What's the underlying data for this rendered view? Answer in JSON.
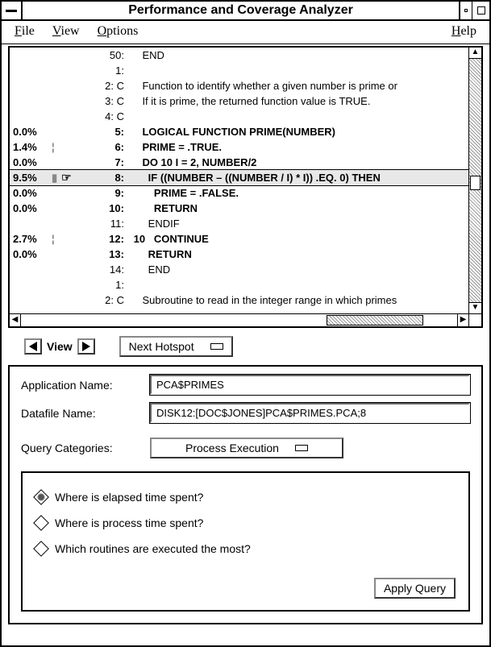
{
  "window": {
    "title": "Performance and Coverage Analyzer"
  },
  "menubar": {
    "file": "File",
    "view": "View",
    "options": "Options",
    "help": "Help"
  },
  "code": {
    "lines": [
      {
        "pct": "",
        "mark": "",
        "ptr": "",
        "lineno": "50:",
        "txt": "    END",
        "bold": false
      },
      {
        "pct": "",
        "mark": "",
        "ptr": "",
        "lineno": "1:",
        "txt": "",
        "bold": false
      },
      {
        "pct": "",
        "mark": "",
        "ptr": "",
        "lineno": "2: C",
        "txt": "    Function to identify whether a given number is prime or",
        "bold": false
      },
      {
        "pct": "",
        "mark": "",
        "ptr": "",
        "lineno": "3: C",
        "txt": "    If it is prime, the returned function value is TRUE.",
        "bold": false
      },
      {
        "pct": "",
        "mark": "",
        "ptr": "",
        "lineno": "4: C",
        "txt": "",
        "bold": false
      },
      {
        "pct": "0.0%",
        "mark": "",
        "ptr": "",
        "lineno": "5:",
        "txt": "    LOGICAL FUNCTION PRIME(NUMBER)",
        "bold": true
      },
      {
        "pct": "1.4%",
        "mark": "¦",
        "ptr": "",
        "lineno": "6:",
        "txt": "    PRIME = .TRUE.",
        "bold": true
      },
      {
        "pct": "0.0%",
        "mark": "",
        "ptr": "",
        "lineno": "7:",
        "txt": "    DO 10 I = 2, NUMBER/2",
        "bold": true
      },
      {
        "pct": "9.5%",
        "mark": "▮",
        "ptr": "☞",
        "lineno": "8:",
        "txt": "      IF ((NUMBER – ((NUMBER / I) * I)) .EQ. 0) THEN",
        "bold": true,
        "sel": true
      },
      {
        "pct": "0.0%",
        "mark": "",
        "ptr": "",
        "lineno": "9:",
        "txt": "        PRIME = .FALSE.",
        "bold": true
      },
      {
        "pct": "0.0%",
        "mark": "",
        "ptr": "",
        "lineno": "10:",
        "txt": "        RETURN",
        "bold": true
      },
      {
        "pct": "",
        "mark": "",
        "ptr": "",
        "lineno": "11:",
        "txt": "      ENDIF",
        "bold": false
      },
      {
        "pct": "2.7%",
        "mark": "¦",
        "ptr": "",
        "lineno": "12:",
        "txt": " 10   CONTINUE",
        "bold": true
      },
      {
        "pct": "0.0%",
        "mark": "",
        "ptr": "",
        "lineno": "13:",
        "txt": "      RETURN",
        "bold": true
      },
      {
        "pct": "",
        "mark": "",
        "ptr": "",
        "lineno": "14:",
        "txt": "      END",
        "bold": false
      },
      {
        "pct": "",
        "mark": "",
        "ptr": "",
        "lineno": "1:",
        "txt": "",
        "bold": false
      },
      {
        "pct": "",
        "mark": "",
        "ptr": "",
        "lineno": "2: C",
        "txt": "    Subroutine to read in the integer range in which primes",
        "bold": false
      }
    ]
  },
  "viewbar": {
    "view_label": "View",
    "next_hotspot": "Next Hotspot"
  },
  "form": {
    "app_name_label": "Application Name:",
    "app_name_value": "PCA$PRIMES",
    "datafile_label": "Datafile Name:",
    "datafile_value": "DISK12:[DOC$JONES]PCA$PRIMES.PCA;8",
    "query_cat_label": "Query Categories:",
    "query_cat_value": "Process Execution"
  },
  "queries": {
    "q1": "Where is elapsed time spent?",
    "q2": "Where is process time spent?",
    "q3": "Which routines are executed the most?",
    "apply": "Apply Query"
  }
}
